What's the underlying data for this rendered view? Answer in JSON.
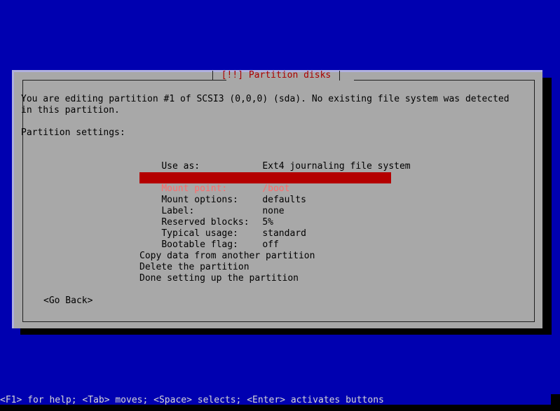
{
  "screen": {
    "background_color": "#0000b0"
  },
  "dialog": {
    "title": "[!!] Partition disks",
    "title_color": "#aa0000",
    "background_color": "#a8a8a8",
    "intro_line_1": "You are editing partition #1 of SCSI3 (0,0,0) (sda). No existing file system was detected",
    "intro_line_2": "in this partition.",
    "settings_heading": "Partition settings:",
    "settings": [
      {
        "label": "Use as:",
        "value": "Ext4 journaling file system",
        "selected": false
      },
      {
        "label": "Mount point:",
        "value": "/boot",
        "selected": true
      },
      {
        "label": "Mount options:",
        "value": "defaults",
        "selected": false
      },
      {
        "label": "Label:",
        "value": "none",
        "selected": false
      },
      {
        "label": "Reserved blocks:",
        "value": "5%",
        "selected": false
      },
      {
        "label": "Typical usage:",
        "value": "standard",
        "selected": false
      },
      {
        "label": "Bootable flag:",
        "value": "off",
        "selected": false
      }
    ],
    "selection_background_color": "#b40000",
    "selection_text_color": "#ff6a6a",
    "actions": [
      "Copy data from another partition",
      "Delete the partition",
      "Done setting up the partition"
    ],
    "go_back_button": "<Go Back>"
  },
  "help_bar": {
    "text": "<F1> for help; <Tab> moves; <Space> selects; <Enter> activates buttons",
    "text_color": "#d8d8d8"
  }
}
